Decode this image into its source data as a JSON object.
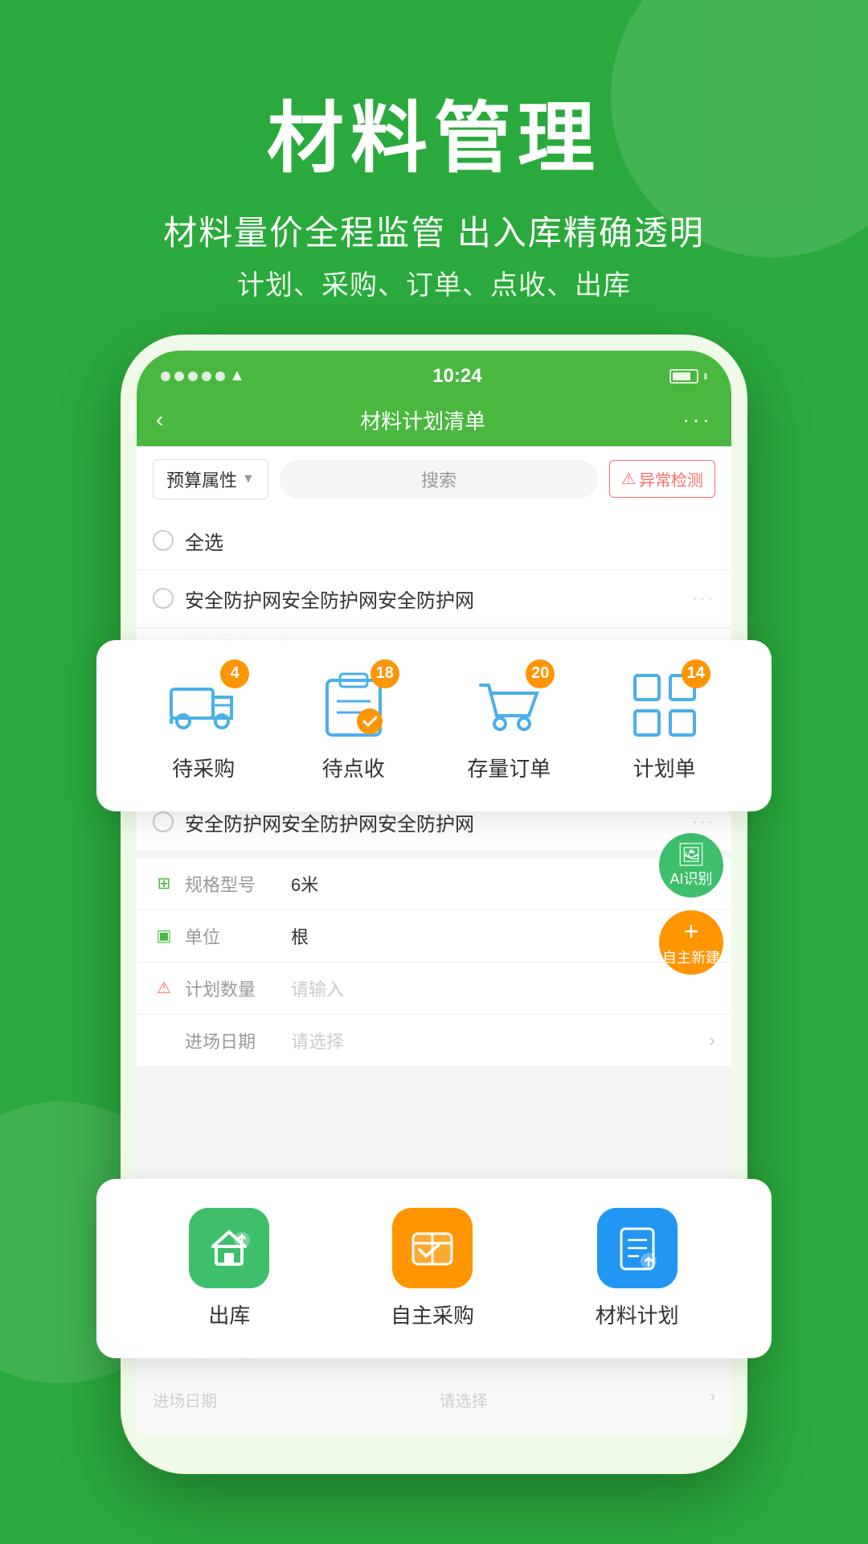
{
  "page": {
    "background_color": "#2aaa3c",
    "title": "材料管理",
    "subtitle_main": "材料量价全程监管  出入库精确透明",
    "subtitle_sub": "计划、采购、订单、点收、出库"
  },
  "phone": {
    "status_bar": {
      "time": "10:24"
    },
    "nav": {
      "title": "材料计划清单",
      "back": "‹",
      "more": "···"
    },
    "filter": {
      "label": "预算属性",
      "search_placeholder": "搜索",
      "anomaly_btn": "异常检测"
    },
    "select_all": "全选",
    "list_items": [
      {
        "title": "安全防护网安全防护网安全防护网",
        "detail1_key": "规格型号",
        "detail1_value": "6米",
        "detail2_key": "单位",
        "detail2_value": "根",
        "detail3_key": "计划数量",
        "detail3_placeholder": "请输入",
        "detail4_key": "进场日期",
        "detail4_placeholder": "请选择"
      }
    ]
  },
  "quick_actions_top": {
    "items": [
      {
        "label": "待采购",
        "badge": "4"
      },
      {
        "label": "待点收",
        "badge": "18"
      },
      {
        "label": "存量订单",
        "badge": "20"
      },
      {
        "label": "计划单",
        "badge": "14"
      }
    ]
  },
  "quick_actions_bottom": {
    "items": [
      {
        "label": "出库",
        "icon_color": "green"
      },
      {
        "label": "自主采购",
        "icon_color": "orange"
      },
      {
        "label": "材料计划",
        "icon_color": "blue"
      }
    ]
  },
  "float_buttons": {
    "ai": "AI识别",
    "create": "自主新建",
    "create_icon": "+"
  },
  "icons": {
    "truck": "truck-icon",
    "clipboard": "clipboard-icon",
    "cart": "cart-icon",
    "grid": "grid-icon",
    "house": "house-icon",
    "shopping_cart_box": "shopping-cart-box-icon",
    "document": "document-icon"
  }
}
